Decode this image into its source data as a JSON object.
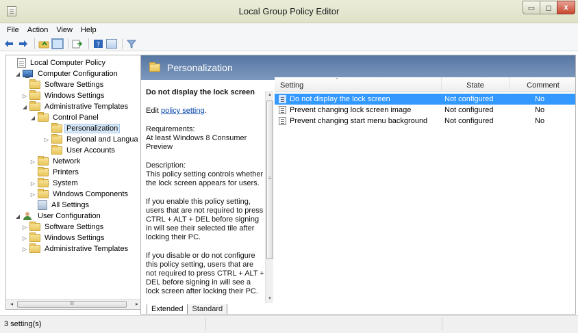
{
  "window": {
    "title": "Local Group Policy Editor",
    "controls": {
      "minimize": "▭",
      "maximize": "◻",
      "close": "x"
    }
  },
  "menu": {
    "items": [
      "File",
      "Action",
      "View",
      "Help"
    ]
  },
  "toolbar": {
    "buttons": [
      "back-arrow-icon",
      "forward-arrow-icon",
      "up-folder-icon",
      "show-hide-tree-icon",
      "export-list-icon",
      "help-icon",
      "properties-icon",
      "filter-icon"
    ]
  },
  "tree": {
    "nodes": [
      {
        "label": "Local Computer Policy",
        "icon": "policy-icon",
        "level": 0,
        "expander": ""
      },
      {
        "label": "Computer Configuration",
        "icon": "computer-icon",
        "level": 1,
        "expander": "◢"
      },
      {
        "label": "Software Settings",
        "icon": "folder-icon",
        "level": 2,
        "expander": ""
      },
      {
        "label": "Windows Settings",
        "icon": "folder-icon",
        "level": 2,
        "expander": "▷"
      },
      {
        "label": "Administrative Templates",
        "icon": "folder-icon",
        "level": 2,
        "expander": "◢"
      },
      {
        "label": "Control Panel",
        "icon": "folder-icon",
        "level": 3,
        "expander": "◢"
      },
      {
        "label": "Personalization",
        "icon": "folder-icon",
        "level": 4,
        "expander": "",
        "selected": true
      },
      {
        "label": "Regional and Langua",
        "icon": "folder-icon",
        "level": 4,
        "expander": "▷"
      },
      {
        "label": "User Accounts",
        "icon": "folder-icon",
        "level": 4,
        "expander": ""
      },
      {
        "label": "Network",
        "icon": "folder-icon",
        "level": 3,
        "expander": "▷"
      },
      {
        "label": "Printers",
        "icon": "folder-icon",
        "level": 3,
        "expander": ""
      },
      {
        "label": "System",
        "icon": "folder-icon",
        "level": 3,
        "expander": "▷"
      },
      {
        "label": "Windows Components",
        "icon": "folder-icon",
        "level": 3,
        "expander": "▷"
      },
      {
        "label": "All Settings",
        "icon": "allsettings-icon",
        "level": 3,
        "expander": ""
      },
      {
        "label": "User Configuration",
        "icon": "user-icon",
        "level": 1,
        "expander": "◢"
      },
      {
        "label": "Software Settings",
        "icon": "folder-icon",
        "level": 2,
        "expander": "▷"
      },
      {
        "label": "Windows Settings",
        "icon": "folder-icon",
        "level": 2,
        "expander": "▷"
      },
      {
        "label": "Administrative Templates",
        "icon": "folder-icon",
        "level": 2,
        "expander": "▷"
      }
    ],
    "scrollbar": {
      "left_arrow": "◂",
      "right_arrow": "▸",
      "grip": "III"
    }
  },
  "panel": {
    "header_title": "Personalization",
    "description": {
      "title": "Do not display the lock screen",
      "edit_prefix": "Edit ",
      "edit_link": "policy setting",
      "edit_suffix": ".",
      "requirements_label": "Requirements:",
      "requirements_text": "At least Windows 8 Consumer Preview",
      "description_label": "Description:",
      "description_text": "This policy setting controls whether the lock screen appears for users.",
      "enable_text": "If you enable this policy setting, users that are not required to press CTRL + ALT + DEL before signing in will see their selected tile after locking their PC.",
      "disable_text": "If you disable or do not configure this policy setting, users that are not required to press CTRL + ALT + DEL before signing in will see a lock screen after locking their PC."
    },
    "desc_scrollbar": {
      "up_arrow": "▴",
      "down_arrow": "▾",
      "grip": "≡"
    },
    "columns": {
      "setting": "Setting",
      "state": "State",
      "comment": "Comment",
      "sort_caret": "⌃"
    },
    "rows": [
      {
        "setting": "Do not display the lock screen",
        "state": "Not configured",
        "comment": "No",
        "selected": true
      },
      {
        "setting": "Prevent changing lock screen image",
        "state": "Not configured",
        "comment": "No",
        "selected": false
      },
      {
        "setting": "Prevent changing start menu background",
        "state": "Not configured",
        "comment": "No",
        "selected": false
      }
    ],
    "tabs": [
      "Extended",
      "Standard"
    ]
  },
  "status": {
    "text": "3 setting(s)"
  },
  "colors": {
    "header_band": "#5677a3",
    "selection": "#3399ff",
    "link": "#0645ad"
  }
}
